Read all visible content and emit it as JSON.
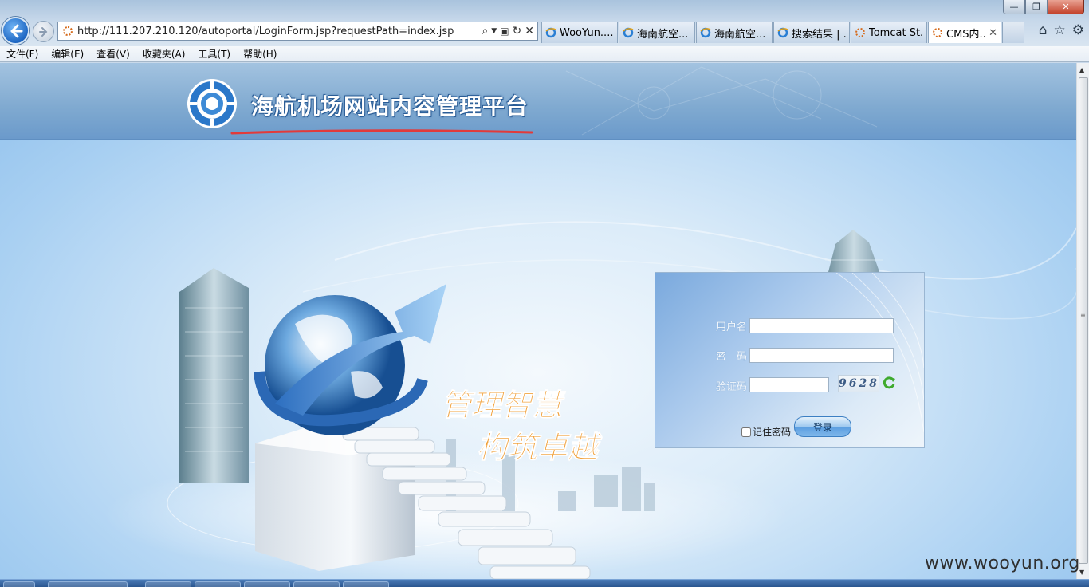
{
  "browser": {
    "address_url": "http://111.207.210.120/autoportal/LoginForm.jsp?requestPath=index.jsp",
    "tabs": [
      {
        "label": "WooYun....",
        "icon": "ie-icon",
        "active": false
      },
      {
        "label": "海南航空...",
        "icon": "ie-icon",
        "active": false
      },
      {
        "label": "海南航空...",
        "icon": "ie-icon",
        "active": false
      },
      {
        "label": "搜索结果 | ...",
        "icon": "ie-icon",
        "active": false
      },
      {
        "label": "Tomcat St...",
        "icon": "loading-icon",
        "active": false
      },
      {
        "label": "CMS内...",
        "icon": "loading-icon",
        "active": true
      }
    ],
    "menu": [
      "文件(F)",
      "编辑(E)",
      "查看(V)",
      "收藏夹(A)",
      "工具(T)",
      "帮助(H)"
    ],
    "window_controls": {
      "minimize": "—",
      "maximize": "❐",
      "close": "✕"
    }
  },
  "page": {
    "site_title": "海航机场网站内容管理平台",
    "slogan_line1": "管理智慧",
    "slogan_line2": "构筑卓越",
    "login": {
      "username_label": "用户名",
      "password_label": "密　码",
      "captcha_label": "验证码",
      "captcha_value": "9628",
      "remember_label": "记住密码",
      "submit_label": "登录",
      "username_value": "",
      "password_value": "",
      "captcha_input_value": ""
    }
  },
  "watermark": "www.wooyun.org",
  "colors": {
    "header_band": "#7fa9d0",
    "title_underline": "#e23a3a",
    "login_button": "#5a9de0",
    "page_background": "#a9d0f2"
  }
}
